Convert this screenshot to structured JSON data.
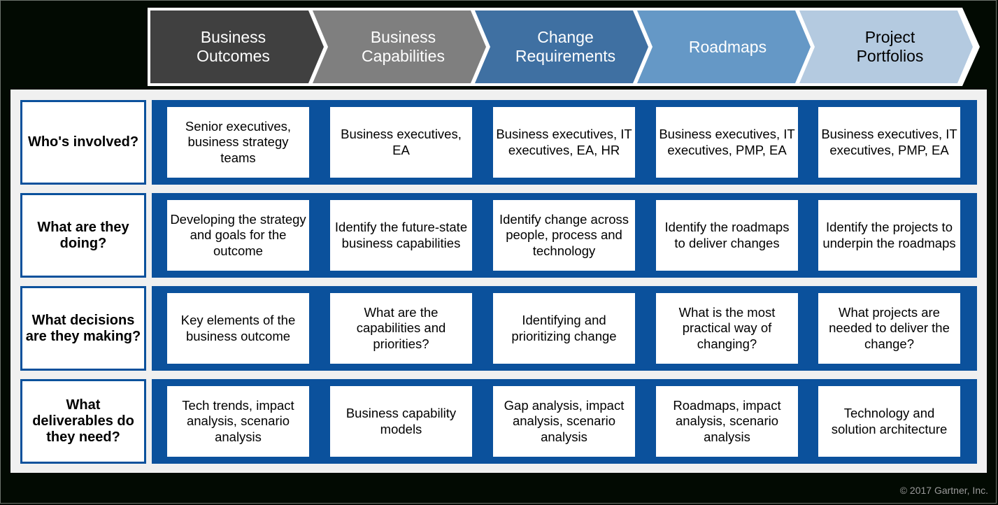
{
  "phases": [
    {
      "label": "Business\nOutcomes",
      "color": "#404040",
      "text_color": "#ffffff"
    },
    {
      "label": "Business\nCapabilities",
      "color": "#7f7f7f",
      "text_color": "#ffffff"
    },
    {
      "label": "Change\nRequirements",
      "color": "#3f70a2",
      "text_color": "#ffffff"
    },
    {
      "label": "Roadmaps",
      "color": "#6598c6",
      "text_color": "#ffffff"
    },
    {
      "label": "Project\nPortfolios",
      "color": "#b4cae0",
      "text_color": "#000000"
    }
  ],
  "rows": [
    {
      "question": "Who's involved?",
      "cells": [
        "Senior executives, business strategy teams",
        "Business executives, EA",
        "Business executives, IT executives, EA, HR",
        "Business executives, IT executives, PMP, EA",
        "Business executives, IT executives, PMP, EA"
      ]
    },
    {
      "question": "What are they doing?",
      "cells": [
        "Developing the strategy and goals for the outcome",
        "Identify the future-state business capabilities",
        "Identify change across people, process and technology",
        "Identify the roadmaps to deliver changes",
        "Identify the projects to underpin the roadmaps"
      ]
    },
    {
      "question": "What decisions are they making?",
      "cells": [
        "Key elements of the business outcome",
        "What are the capabilities and priorities?",
        "Identifying and prioritizing change",
        "What is the most practical way of changing?",
        "What projects are needed to deliver the change?"
      ]
    },
    {
      "question": "What deliverables do they need?",
      "cells": [
        "Tech trends, impact analysis, scenario analysis",
        "Business capability models",
        "Gap analysis, impact analysis, scenario analysis",
        "Roadmaps, impact analysis, scenario analysis",
        "Technology and solution architecture"
      ]
    }
  ],
  "colors": {
    "band_blue": "#0b519c",
    "panel_bg": "#f0f0f0",
    "background": "#020a02"
  },
  "footer": {
    "copyright": "© 2017 Gartner, Inc."
  }
}
